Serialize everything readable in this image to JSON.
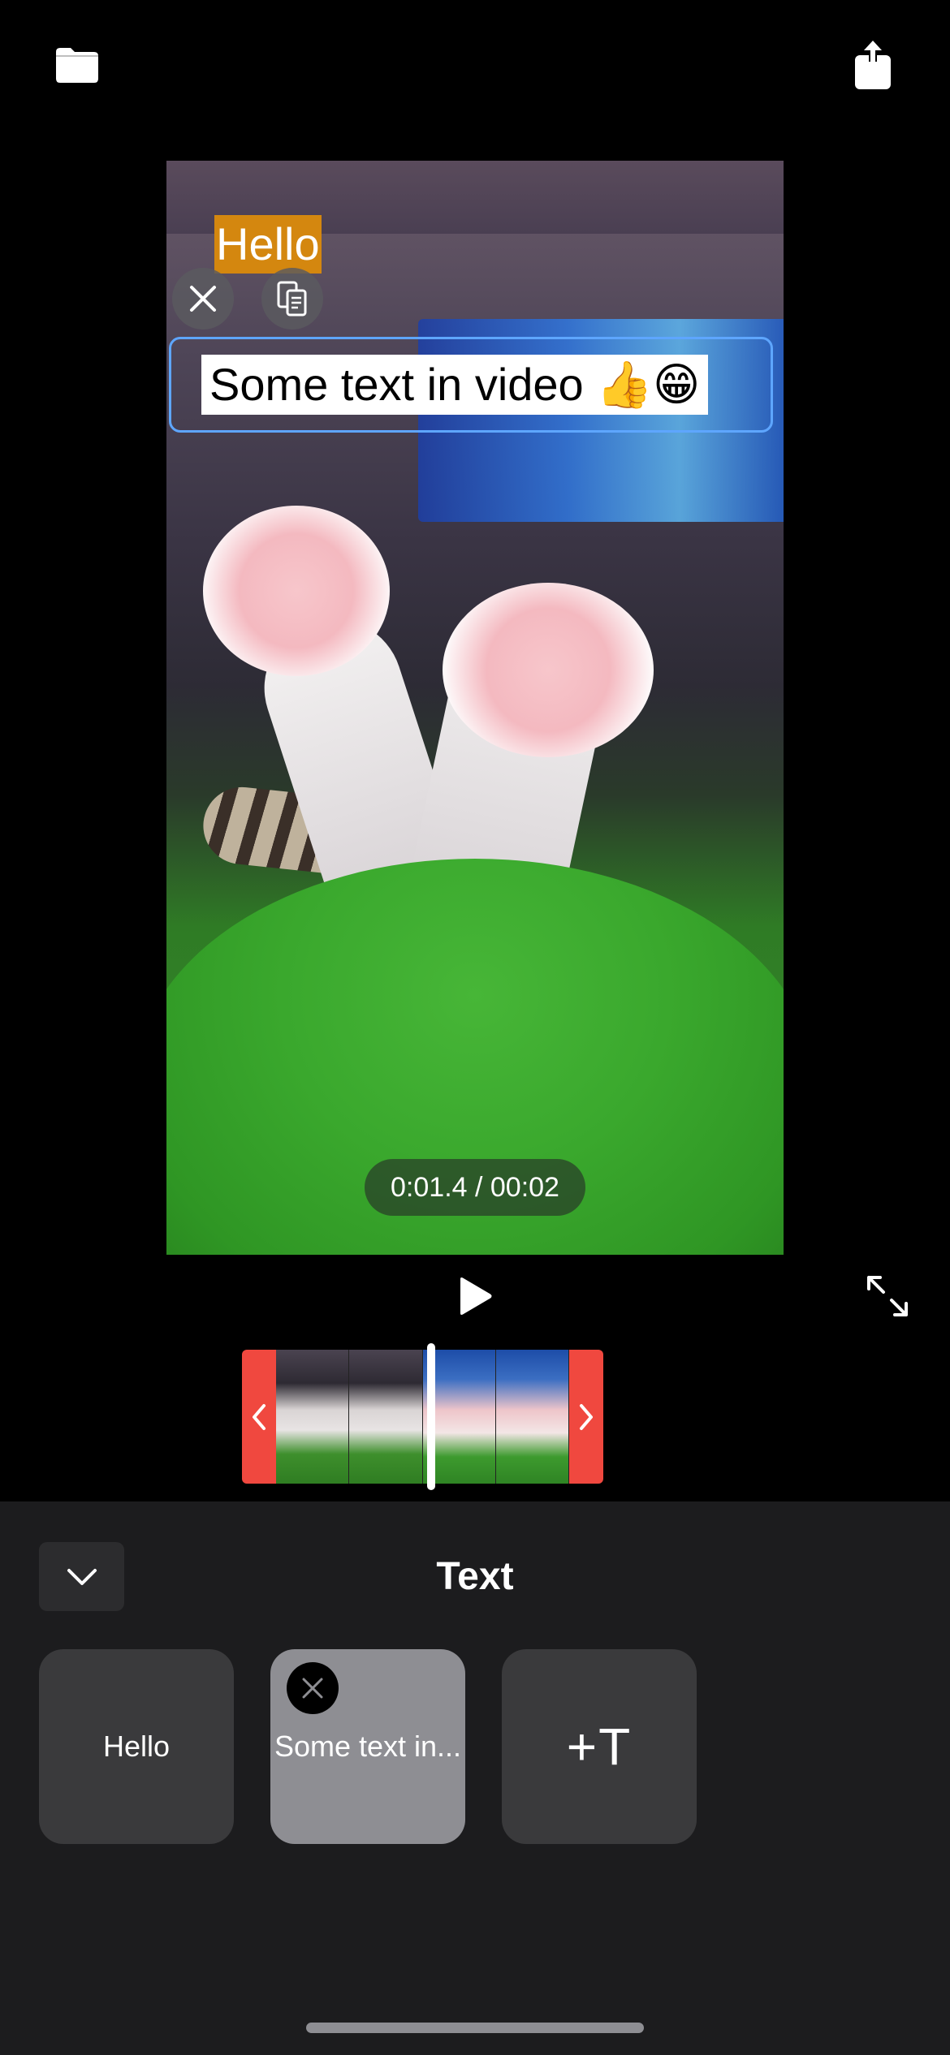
{
  "toolbar": {
    "open_icon": "folder-icon",
    "share_icon": "share-icon"
  },
  "video": {
    "overlays": [
      {
        "text": "Hello",
        "background": "#d4870f",
        "color": "#ffffff"
      },
      {
        "text": "Some text in video 👍😁",
        "background": "#ffffff",
        "color": "#000000",
        "selected": true
      }
    ],
    "selection_color": "#5ea6ff",
    "time_display": "0:01.4 / 00:02"
  },
  "controls": {
    "play_icon": "play-icon",
    "expand_icon": "expand-icon"
  },
  "timeline": {
    "handle_color": "#f0483f",
    "playhead_position": 0.53
  },
  "panel": {
    "title": "Text",
    "collapse_icon": "chevron-down-icon",
    "items": [
      {
        "label": "Hello",
        "selected": false
      },
      {
        "label": "Some text in...",
        "selected": true
      }
    ],
    "add_label": "+T"
  }
}
